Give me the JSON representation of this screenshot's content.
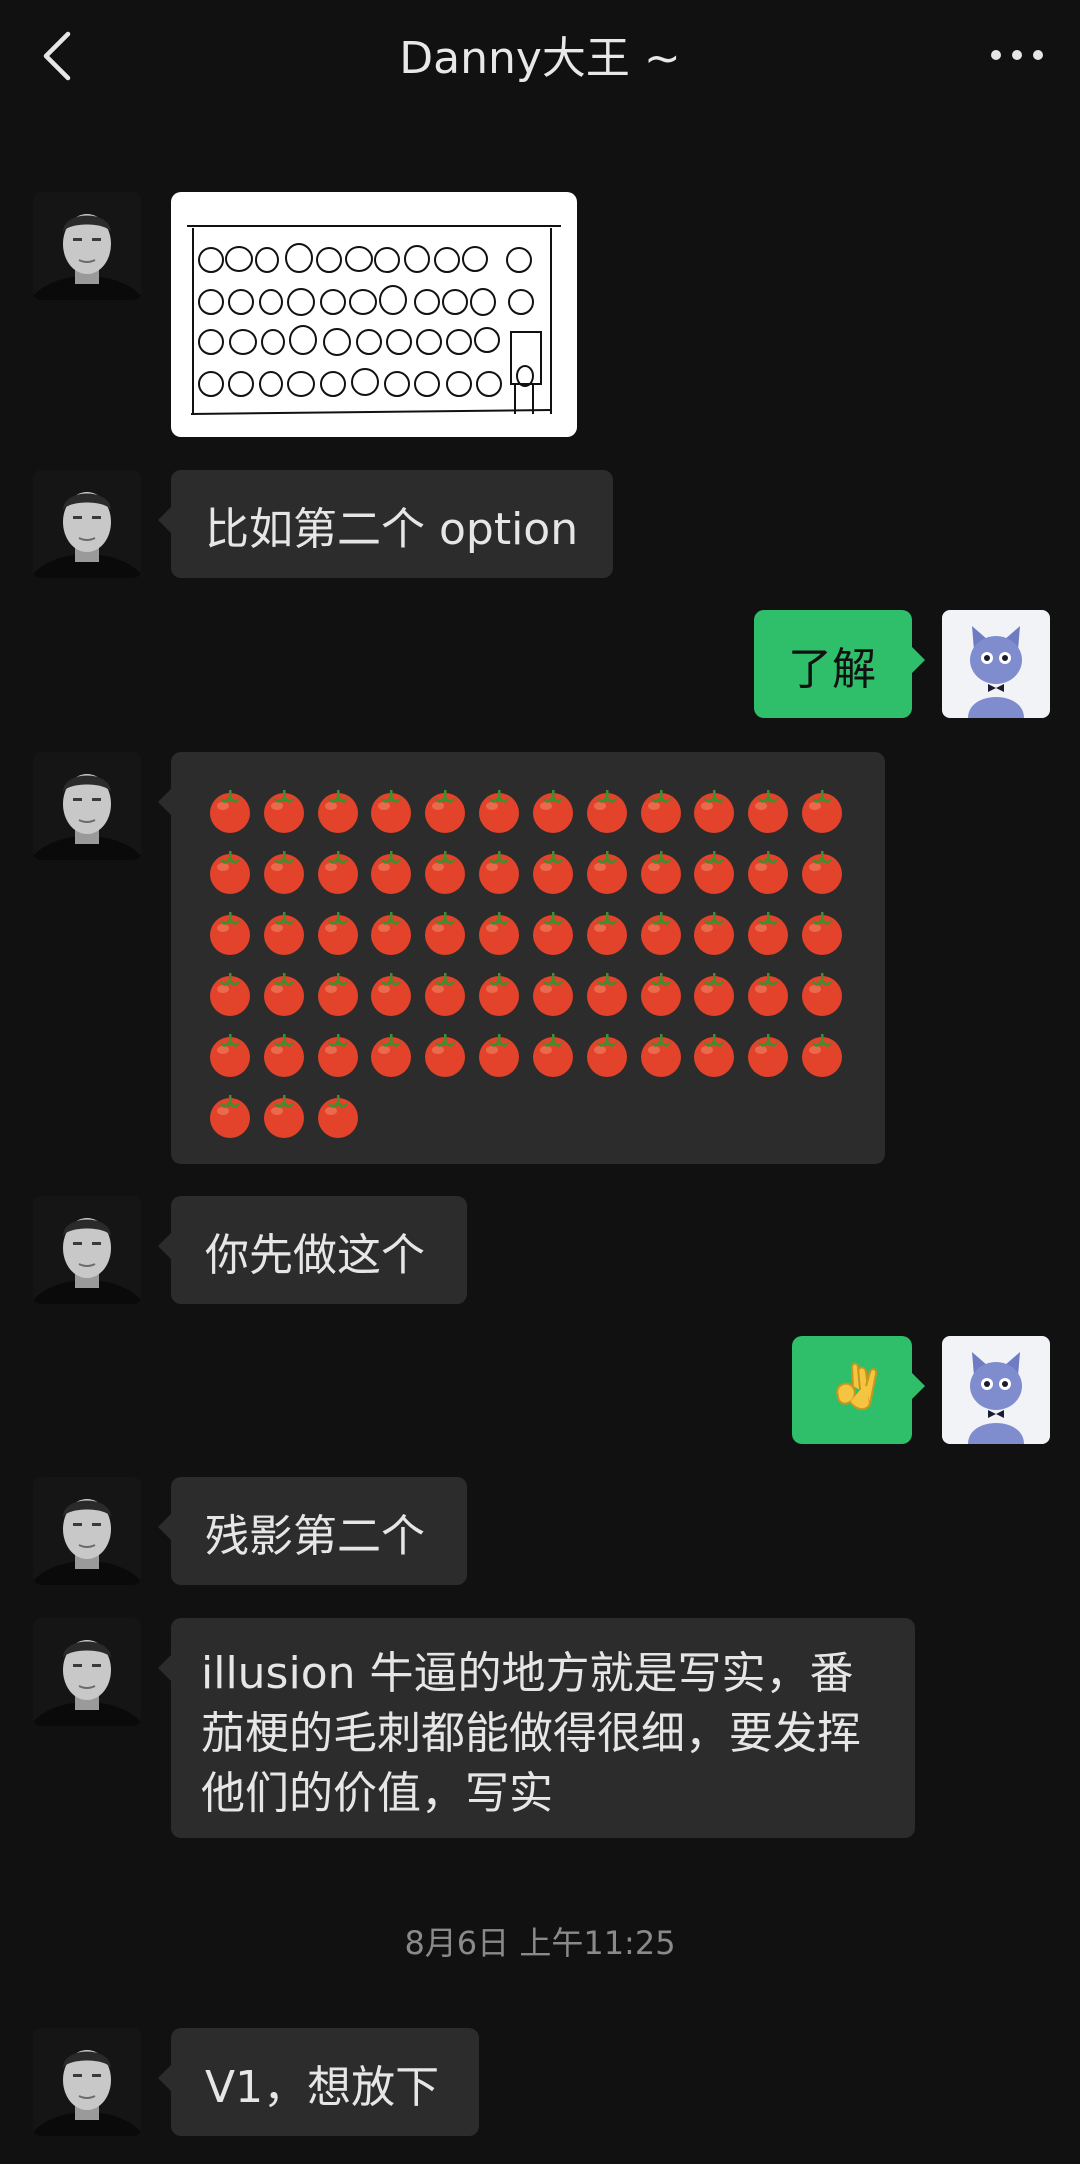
{
  "header": {
    "title": "Danny大王 ~"
  },
  "icons": {
    "back": "chevron-left-icon",
    "more": "more-dots-icon",
    "ok": "ok-hand-emoji",
    "tomato": "tomato-emoji"
  },
  "colors": {
    "background": "#111111",
    "incoming_bubble": "#2c2c2c",
    "outgoing_bubble": "#2fbf6a",
    "timestamp_text": "#8a8a8a"
  },
  "messages": [
    {
      "sender": "contact",
      "type": "image"
    },
    {
      "sender": "contact",
      "type": "text",
      "text": "比如第二个 option"
    },
    {
      "sender": "me",
      "type": "text",
      "text": "了解"
    },
    {
      "sender": "contact",
      "type": "emoji",
      "emoji": "tomato",
      "count": 63
    },
    {
      "sender": "contact",
      "type": "text",
      "text": "你先做这个"
    },
    {
      "sender": "me",
      "type": "emoji",
      "emoji": "ok-hand"
    },
    {
      "sender": "contact",
      "type": "text",
      "text": "残影第二个"
    },
    {
      "sender": "contact",
      "type": "text",
      "text": "illusion 牛逼的地方就是写实，番茄梗的毛刺都能做得很细，要发挥他们的价值，写实"
    },
    {
      "sender": "contact",
      "type": "text",
      "text": "V1，想放下"
    }
  ],
  "timestamp": "8月6日 上午11:25"
}
